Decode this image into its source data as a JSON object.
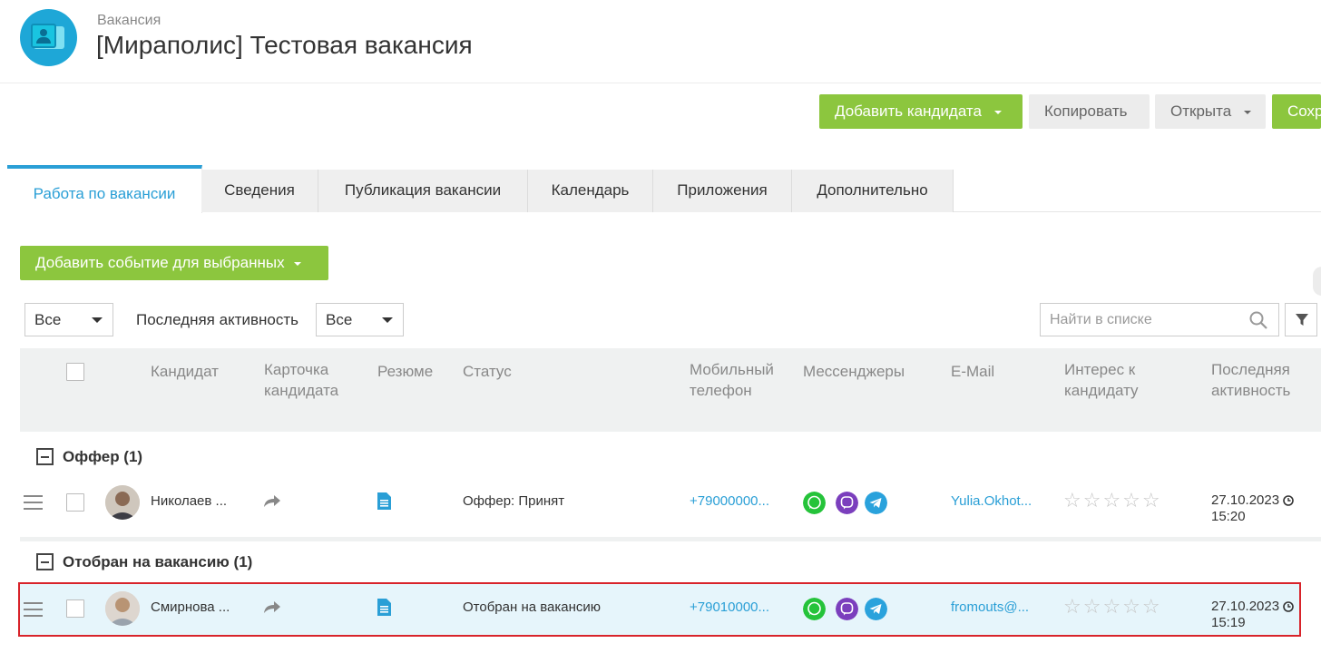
{
  "header": {
    "subtitle": "Вакансия",
    "title": "[Мираполис] Тестовая вакансия"
  },
  "toolbar": {
    "add_candidate": "Добавить кандидата",
    "copy": "Копировать",
    "status": "Открыта",
    "save": "Сохр"
  },
  "tabs": [
    "Работа по вакансии",
    "Сведения",
    "Публикация вакансии",
    "Календарь",
    "Приложения",
    "Дополнительно"
  ],
  "actions": {
    "add_event": "Добавить событие для выбранных"
  },
  "filters": {
    "all_select": "Все",
    "last_activity_label": "Последняя активность",
    "last_activity_select": "Все",
    "search_placeholder": "Найти в списке"
  },
  "table": {
    "columns": {
      "candidate": "Кандидат",
      "card": "Карточка кандидата",
      "resume": "Резюме",
      "status": "Статус",
      "phone": "Мобильный телефон",
      "messengers": "Мессенджеры",
      "email": "E-Mail",
      "interest": "Интерес к кандидату",
      "last_activity": "Последняя активность"
    },
    "groups": [
      {
        "title": "Оффер (1)",
        "rows": [
          {
            "name": "Николаев ...",
            "status": "Оффер: Принят",
            "phone": "+79000000...",
            "email": "Yulia.Okhot...",
            "date": "27.10.2023",
            "time": "15:20",
            "rating": 0
          }
        ]
      },
      {
        "title": "Отобран на вакансию (1)",
        "rows": [
          {
            "name": "Смирнова ...",
            "status": "Отобран на вакансию",
            "phone": "+79010000...",
            "email": "fromouts@...",
            "date": "27.10.2023",
            "time": "15:19",
            "rating": 0
          }
        ]
      }
    ]
  },
  "colors": {
    "accent_blue": "#2a9fd6",
    "green": "#8cc63e",
    "selected_border": "#d8232a",
    "whatsapp": "#25c33a",
    "viber": "#7b3fbd",
    "telegram": "#2aa2dc"
  }
}
